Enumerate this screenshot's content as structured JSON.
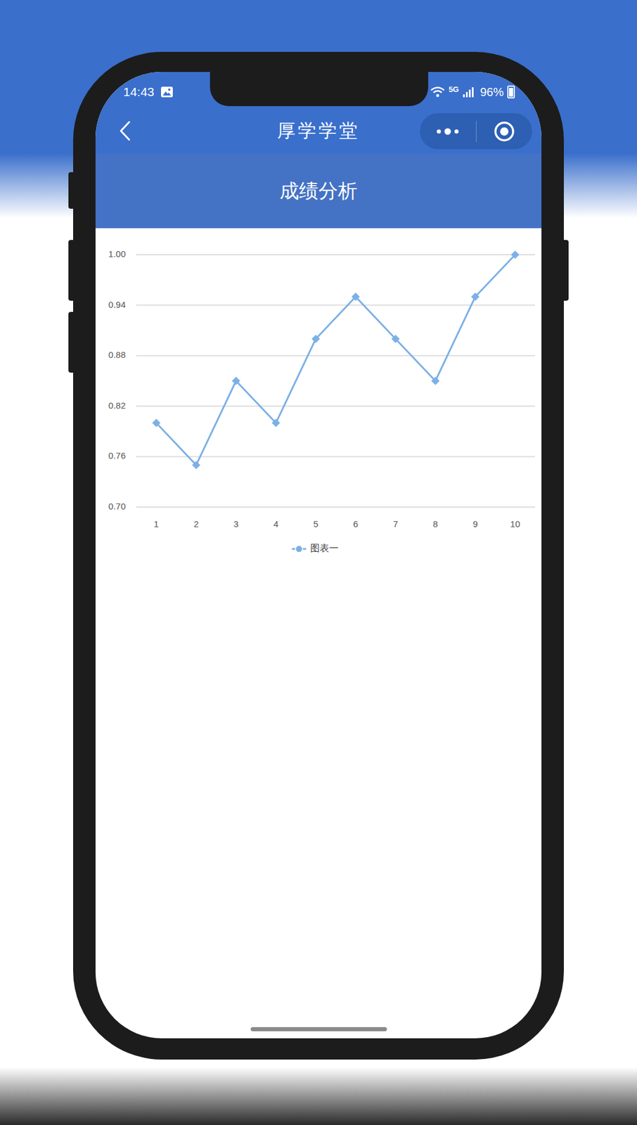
{
  "status_bar": {
    "time": "14:43",
    "network": "5G",
    "battery": "96%",
    "battery_level": 0.96
  },
  "nav_bar": {
    "title": "厚学学堂"
  },
  "header": {
    "title": "成绩分析"
  },
  "chart": {
    "y_ticks": [
      "1.00",
      "0.94",
      "0.88",
      "0.82",
      "0.76",
      "0.70"
    ],
    "x_labels": [
      "1",
      "2",
      "3",
      "4",
      "5",
      "6",
      "7",
      "8",
      "9",
      "10"
    ],
    "series": [
      {
        "name": "图表一",
        "values": [
          0.8,
          0.75,
          0.85,
          0.8,
          0.9,
          0.95,
          0.9,
          0.85,
          0.95,
          1.0
        ]
      }
    ]
  }
}
